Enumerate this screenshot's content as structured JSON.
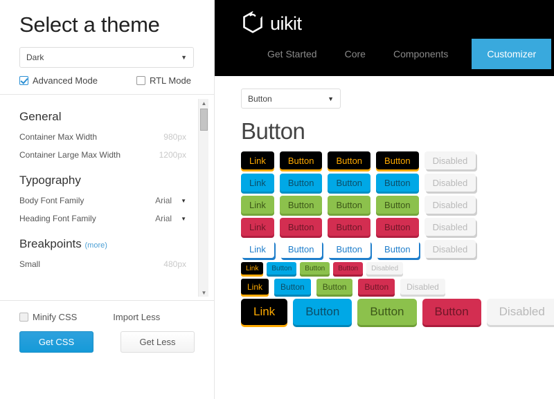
{
  "sidebar": {
    "title": "Select a theme",
    "theme_select": {
      "value": "Dark",
      "caret": "chevron-down-icon"
    },
    "modes": [
      {
        "label": "Advanced Mode",
        "checked": true
      },
      {
        "label": "RTL Mode",
        "checked": false
      }
    ],
    "sections": [
      {
        "heading": "General",
        "more": "",
        "options": [
          {
            "label": "Container Max Width",
            "value": "980px"
          },
          {
            "label": "Container Large Max Width",
            "value": "1200px"
          }
        ]
      },
      {
        "heading": "Typography",
        "more": "",
        "options": [
          {
            "label": "Body Font Family",
            "value": "Arial"
          },
          {
            "label": "Heading Font Family",
            "value": "Arial"
          }
        ]
      },
      {
        "heading": "Breakpoints",
        "more": "(more)",
        "options": [
          {
            "label": "Small",
            "value": "480px"
          }
        ]
      }
    ],
    "minify": {
      "label": "Minify CSS",
      "checked": false
    },
    "import_less_label": "Import Less",
    "get_css_label": "Get CSS",
    "get_less_label": "Get Less",
    "scrollbar": {
      "up": "▲",
      "down": "▼"
    }
  },
  "topnav": {
    "brand": "uikit",
    "logo": "uikit-hexagon-logo-icon",
    "tabs": [
      {
        "label": "Get Started",
        "active": false
      },
      {
        "label": "Core",
        "active": false
      },
      {
        "label": "Components",
        "active": false
      },
      {
        "label": "Customizer",
        "active": true
      }
    ]
  },
  "main": {
    "component_select": {
      "value": "Button",
      "caret": "chevron-down-icon"
    },
    "page_title": "Button",
    "button_rows": [
      {
        "name": "default-dark-row",
        "size": "default",
        "buttons": [
          {
            "label": "Link",
            "variant": "dark"
          },
          {
            "label": "Button",
            "variant": "dark"
          },
          {
            "label": "Button",
            "variant": "dark"
          },
          {
            "label": "Button",
            "variant": "dark"
          },
          {
            "label": "Disabled",
            "variant": "disabled"
          }
        ]
      },
      {
        "name": "default-primary-row",
        "size": "default",
        "buttons": [
          {
            "label": "Link",
            "variant": "primary"
          },
          {
            "label": "Button",
            "variant": "primary"
          },
          {
            "label": "Button",
            "variant": "primary"
          },
          {
            "label": "Button",
            "variant": "primary"
          },
          {
            "label": "Disabled",
            "variant": "disabled"
          }
        ]
      },
      {
        "name": "default-success-row",
        "size": "default",
        "buttons": [
          {
            "label": "Link",
            "variant": "success"
          },
          {
            "label": "Button",
            "variant": "success"
          },
          {
            "label": "Button",
            "variant": "success"
          },
          {
            "label": "Button",
            "variant": "success"
          },
          {
            "label": "Disabled",
            "variant": "disabled"
          }
        ]
      },
      {
        "name": "default-danger-row",
        "size": "default",
        "buttons": [
          {
            "label": "Link",
            "variant": "danger"
          },
          {
            "label": "Button",
            "variant": "danger"
          },
          {
            "label": "Button",
            "variant": "danger"
          },
          {
            "label": "Button",
            "variant": "danger"
          },
          {
            "label": "Disabled",
            "variant": "disabled"
          }
        ]
      },
      {
        "name": "default-link-row",
        "size": "default",
        "buttons": [
          {
            "label": "Link",
            "variant": "link"
          },
          {
            "label": "Button",
            "variant": "link"
          },
          {
            "label": "Button",
            "variant": "link"
          },
          {
            "label": "Button",
            "variant": "link"
          },
          {
            "label": "Disabled",
            "variant": "disabled"
          }
        ]
      },
      {
        "name": "mini-row",
        "size": "mini",
        "buttons": [
          {
            "label": "Link",
            "variant": "dark"
          },
          {
            "label": "Button",
            "variant": "primary"
          },
          {
            "label": "Button",
            "variant": "success"
          },
          {
            "label": "Button",
            "variant": "danger"
          },
          {
            "label": "Disabled",
            "variant": "disabled"
          }
        ]
      },
      {
        "name": "small-row",
        "size": "small",
        "buttons": [
          {
            "label": "Link",
            "variant": "dark"
          },
          {
            "label": "Button",
            "variant": "primary"
          },
          {
            "label": "Button",
            "variant": "success"
          },
          {
            "label": "Button",
            "variant": "danger"
          },
          {
            "label": "Disabled",
            "variant": "disabled"
          }
        ]
      },
      {
        "name": "large-row",
        "size": "large",
        "buttons": [
          {
            "label": "Link",
            "variant": "dark"
          },
          {
            "label": "Button",
            "variant": "primary"
          },
          {
            "label": "Button",
            "variant": "success"
          },
          {
            "label": "Button",
            "variant": "danger"
          },
          {
            "label": "Disabled",
            "variant": "disabled"
          }
        ]
      }
    ]
  },
  "colors": {
    "accent_blue": "#00a8e6",
    "nav_active": "#39a9dd",
    "success_green": "#8cc14c",
    "danger_red": "#d32e51",
    "dark_orange_text": "#ffaa00",
    "topnav_bg": "#000000",
    "link_blue": "#1f7ecb"
  }
}
